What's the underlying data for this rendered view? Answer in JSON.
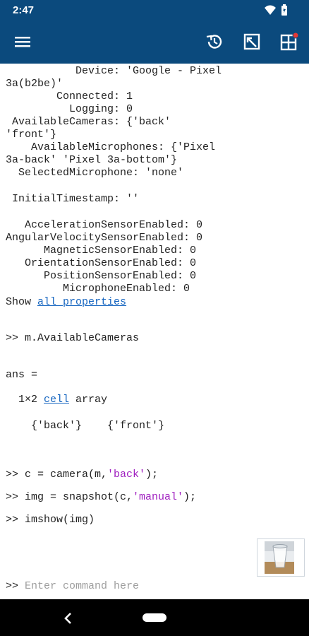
{
  "status": {
    "time": "2:47",
    "icons": [
      "wifi-icon",
      "battery-icon"
    ]
  },
  "appbar": {
    "menu_icon": "hamburger-menu-icon",
    "history_icon": "history-icon",
    "editor_icon": "editor-icon",
    "apps_icon": "apps-icon"
  },
  "console": {
    "properties": [
      {
        "line": "           Device: 'Google - Pixel"
      },
      {
        "line": "3a(b2be)'"
      },
      {
        "line": "        Connected: 1"
      },
      {
        "line": "          Logging: 0"
      },
      {
        "line": " AvailableCameras: {'back'"
      },
      {
        "line": "'front'}"
      },
      {
        "line": "    AvailableMicrophones: {'Pixel"
      },
      {
        "line": "3a-back' 'Pixel 3a-bottom'}"
      },
      {
        "line": "  SelectedMicrophone: 'none'"
      },
      {
        "line": " InitialTimestamp: ''"
      },
      {
        "line": "   AccelerationSensorEnabled: 0"
      },
      {
        "line": "AngularVelocitySensorEnabled: 0"
      },
      {
        "line": "      MagneticSensorEnabled: 0"
      },
      {
        "line": "   OrientationSensorEnabled: 0"
      },
      {
        "line": "      PositionSensorEnabled: 0"
      },
      {
        "line": "         MicrophoneEnabled: 0"
      }
    ],
    "show_prefix": "Show ",
    "show_link": "all properties",
    "cmd1": ">> m.AvailableCameras",
    "ans": "ans =",
    "size_prefix": "  1×2 ",
    "size_link": "cell",
    "size_suffix": " array",
    "cells": "    {'back'}    {'front'}",
    "cmd2_a": ">> c = camera(m,",
    "cmd2_b": "'back'",
    "cmd2_c": ");",
    "cmd3_a": ">> img = snapshot(c,",
    "cmd3_b": "'manual'",
    "cmd3_c": ");",
    "cmd4": ">> imshow(img)",
    "prompt": ">> ",
    "input_placeholder": "Enter command here"
  },
  "navbar": {
    "back_icon": "back-icon",
    "home_icon": "home-pill-icon"
  }
}
